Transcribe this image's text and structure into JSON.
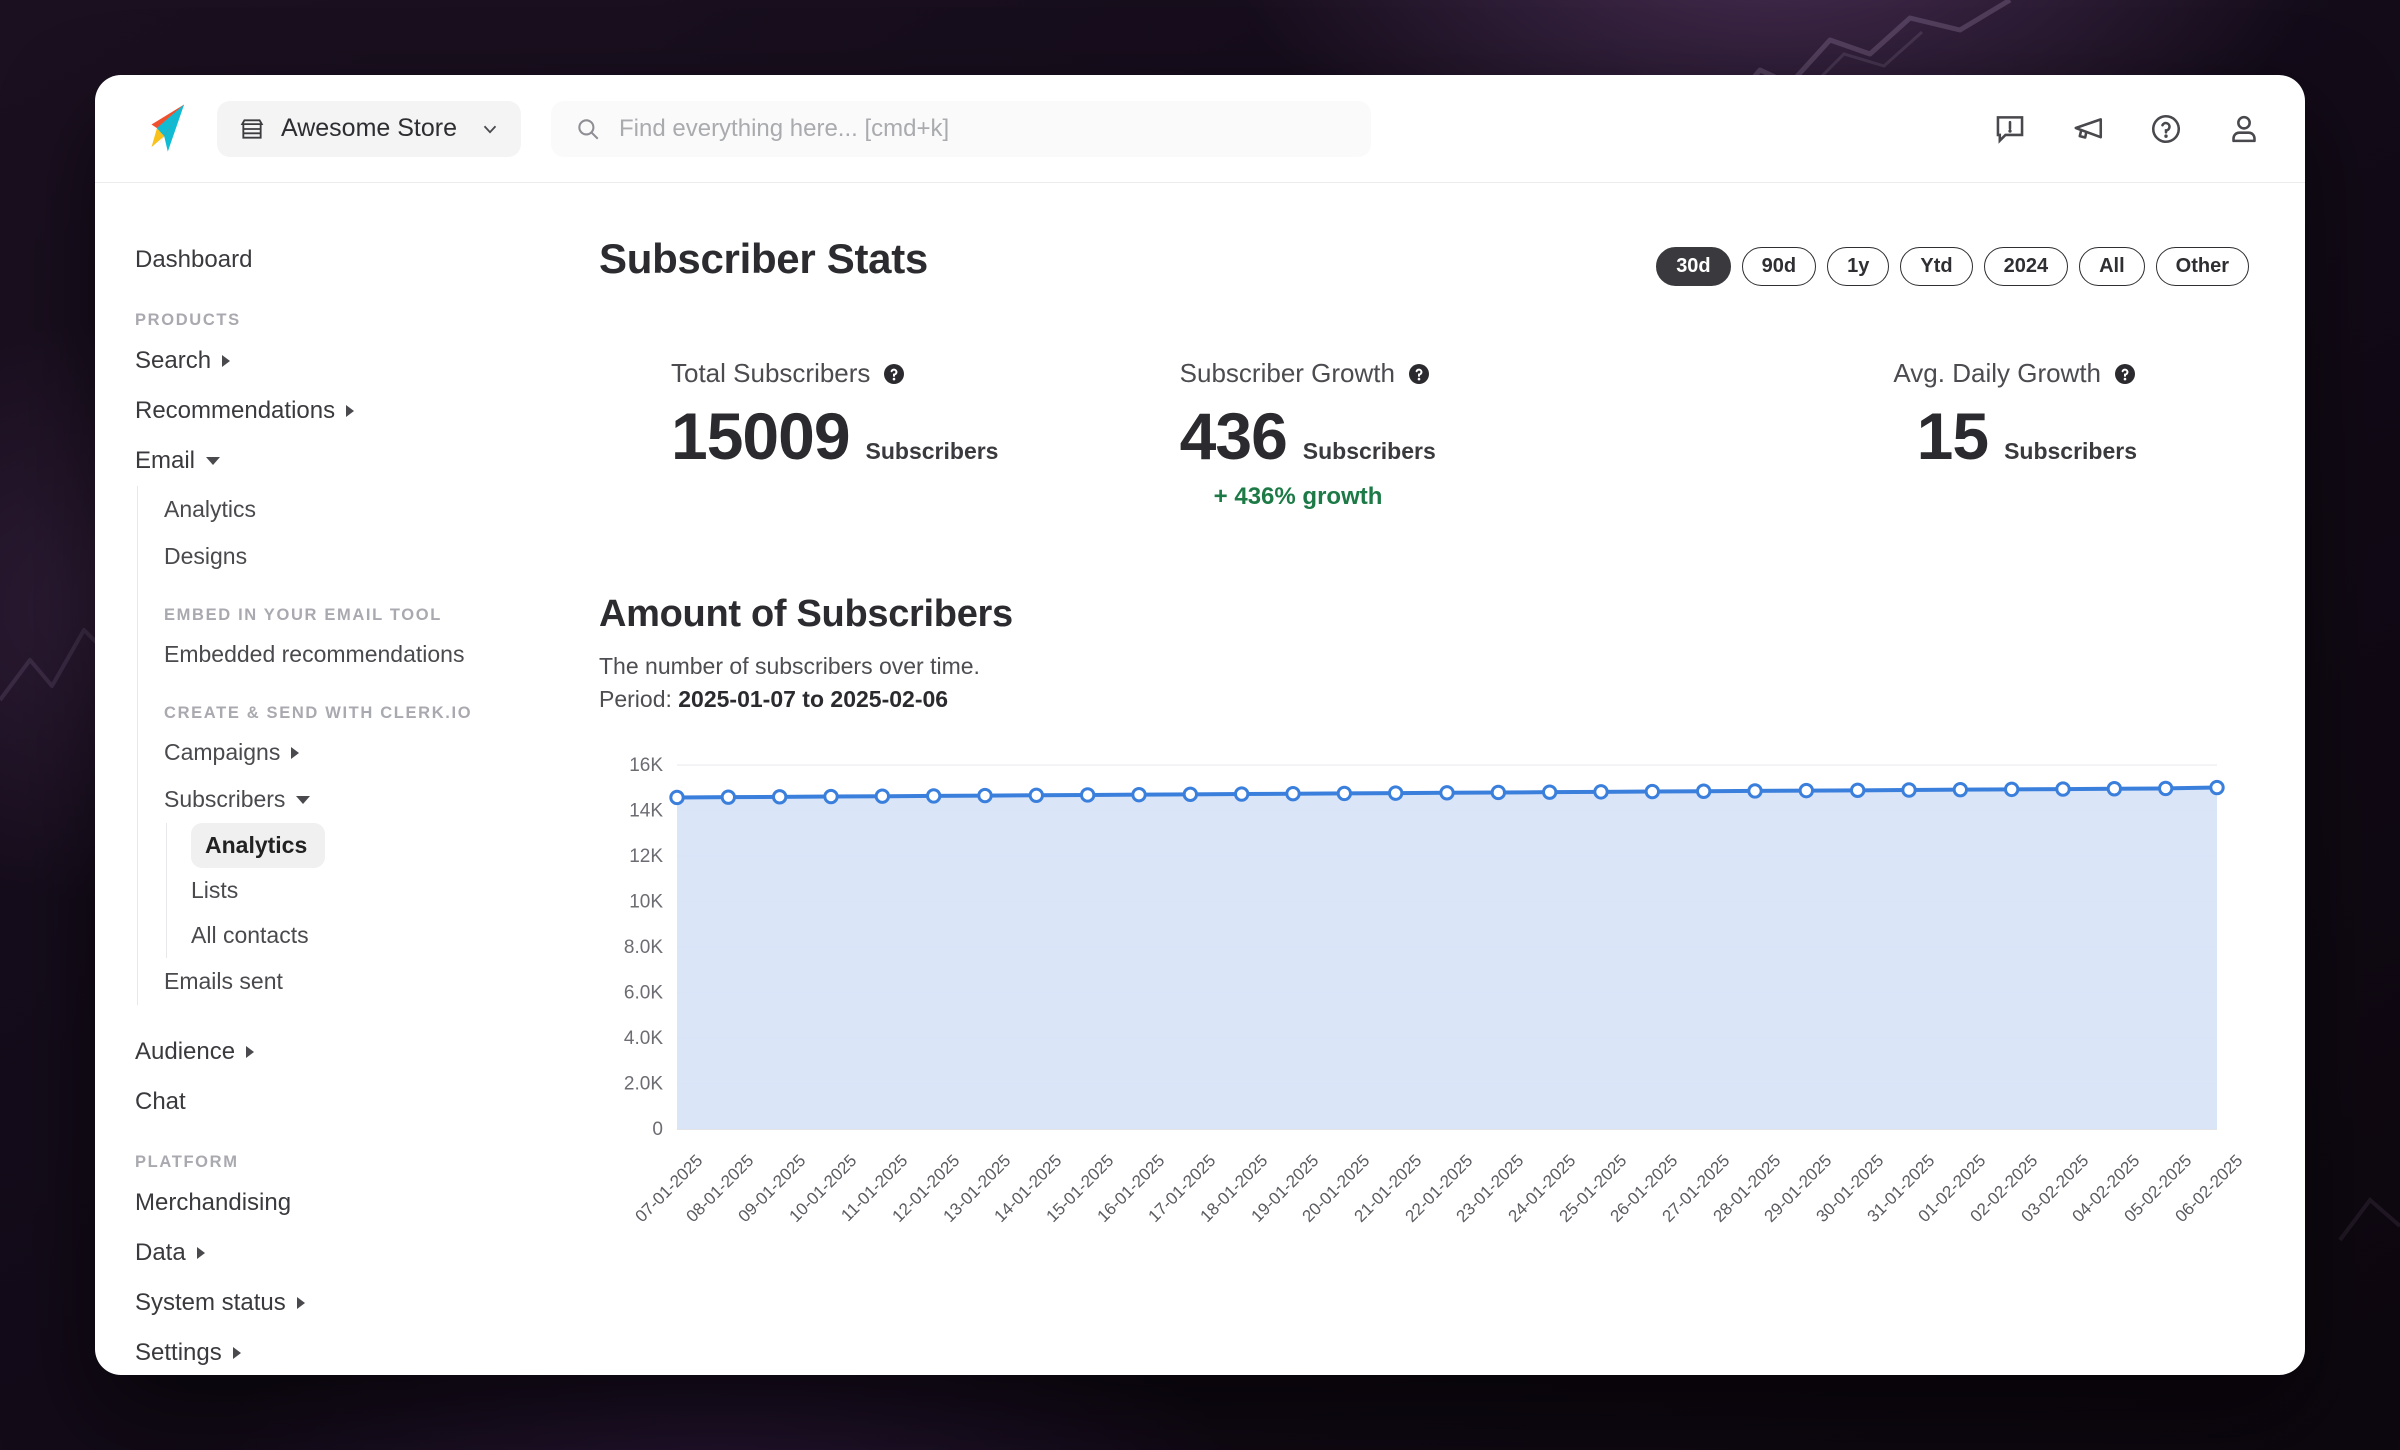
{
  "topbar": {
    "logo_name": "clerk-logo",
    "store": {
      "name": "Awesome Store",
      "icon": "store-icon",
      "chevron": "chevron-down-icon"
    },
    "search": {
      "placeholder": "Find everything here... [cmd+k]",
      "value": "",
      "icon": "search-icon"
    },
    "icons": [
      {
        "name": "feedback-icon",
        "label": "Feedback"
      },
      {
        "name": "announcement-icon",
        "label": "Announcements"
      },
      {
        "name": "help-icon",
        "label": "Help"
      },
      {
        "name": "account-icon",
        "label": "Account"
      }
    ]
  },
  "sidebar": {
    "dashboard": "Dashboard",
    "section_products": "PRODUCTS",
    "search": "Search",
    "recommendations": "Recommendations",
    "email": "Email",
    "email_children": [
      "Analytics",
      "Designs"
    ],
    "section_embed": "EMBED IN YOUR EMAIL TOOL",
    "embedded_recommendations": "Embedded recommendations",
    "section_create": "CREATE & SEND WITH CLERK.IO",
    "campaigns": "Campaigns",
    "subscribers": "Subscribers",
    "subscribers_children": [
      "Analytics",
      "Lists",
      "All contacts"
    ],
    "active_child": "Analytics",
    "emails_sent": "Emails sent",
    "audience": "Audience",
    "chat": "Chat",
    "section_platform": "PLATFORM",
    "merchandising": "Merchandising",
    "data": "Data",
    "system_status": "System status",
    "settings": "Settings"
  },
  "main": {
    "page_title": "Subscriber Stats",
    "ranges": [
      {
        "label": "30d",
        "active": true
      },
      {
        "label": "90d",
        "active": false
      },
      {
        "label": "1y",
        "active": false
      },
      {
        "label": "Ytd",
        "active": false
      },
      {
        "label": "2024",
        "active": false
      },
      {
        "label": "All",
        "active": false
      },
      {
        "label": "Other",
        "active": false
      }
    ],
    "kpis": [
      {
        "label": "Total Subscribers",
        "value": "15009",
        "unit": "Subscribers",
        "growth": ""
      },
      {
        "label": "Subscriber Growth",
        "value": "436",
        "unit": "Subscribers",
        "growth": "+ 436% growth"
      },
      {
        "label": "Avg. Daily Growth",
        "value": "15",
        "unit": "Subscribers",
        "growth": ""
      }
    ],
    "chart_title": "Amount of Subscribers",
    "chart_sub_line1": "The number of subscribers over time.",
    "chart_sub_period_label": "Period: ",
    "chart_sub_period_value": "2025-01-07 to 2025-02-06"
  },
  "colors": {
    "accent_line": "#3b7fdc",
    "accent_fill": "#d8e4f8",
    "growth_green": "#1d7a46",
    "pill_active_bg": "#3a3a3e"
  },
  "chart_data": {
    "type": "area",
    "title": "Amount of Subscribers",
    "subtitle": "The number of subscribers over time. Period: 2025-01-07 to 2025-02-06",
    "xlabel": "",
    "ylabel": "",
    "ylim": [
      0,
      16000
    ],
    "grid": true,
    "legend": "none",
    "ytick_labels": [
      "0",
      "2.0K",
      "4.0K",
      "6.0K",
      "8.0K",
      "10K",
      "12K",
      "14K",
      "16K"
    ],
    "ytick_values": [
      0,
      2000,
      4000,
      6000,
      8000,
      10000,
      12000,
      14000,
      16000
    ],
    "categories": [
      "07-01-2025",
      "08-01-2025",
      "09-01-2025",
      "10-01-2025",
      "11-01-2025",
      "12-01-2025",
      "13-01-2025",
      "14-01-2025",
      "15-01-2025",
      "16-01-2025",
      "17-01-2025",
      "18-01-2025",
      "19-01-2025",
      "20-01-2025",
      "21-01-2025",
      "22-01-2025",
      "23-01-2025",
      "24-01-2025",
      "25-01-2025",
      "26-01-2025",
      "27-01-2025",
      "28-01-2025",
      "29-01-2025",
      "30-01-2025",
      "31-01-2025",
      "01-02-2025",
      "02-02-2025",
      "03-02-2025",
      "04-02-2025",
      "05-02-2025",
      "06-02-2025"
    ],
    "series": [
      {
        "name": "Subscribers",
        "values": [
          14573,
          14586,
          14600,
          14613,
          14627,
          14641,
          14655,
          14668,
          14682,
          14696,
          14710,
          14723,
          14737,
          14751,
          14764,
          14778,
          14792,
          14805,
          14819,
          14833,
          14846,
          14860,
          14874,
          14887,
          14901,
          14915,
          14929,
          14942,
          14956,
          14970,
          15009
        ]
      }
    ]
  }
}
